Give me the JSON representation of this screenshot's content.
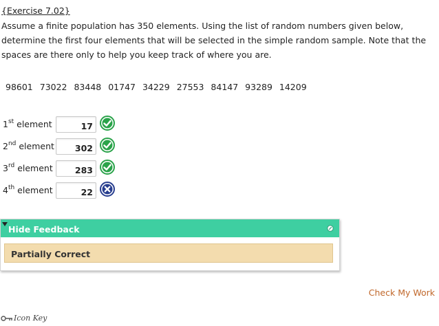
{
  "exercise": {
    "title": "{Exercise 7.02}"
  },
  "question": {
    "text": "Assume a finite population has 350 elements. Using the list of random numbers given below, determine the first four elements that will be selected in the simple random sample. Note that the spaces are there only to help you keep track of where you are."
  },
  "random_numbers": "98601 73022 83448 01747 34229 27553 84147 93289 14209",
  "answers": [
    {
      "ordinal": "1",
      "suffix": "st",
      "label": " element",
      "value": "17",
      "status": "correct",
      "icon": "check-circle-icon"
    },
    {
      "ordinal": "2",
      "suffix": "nd",
      "label": " element",
      "value": "302",
      "status": "correct",
      "icon": "check-circle-icon"
    },
    {
      "ordinal": "3",
      "suffix": "rd",
      "label": " element",
      "value": "283",
      "status": "correct",
      "icon": "check-circle-icon"
    },
    {
      "ordinal": "4",
      "suffix": "th",
      "label": " element",
      "value": "22",
      "status": "incorrect",
      "icon": "x-circle-icon"
    }
  ],
  "feedback": {
    "toggle_label": "Hide Feedback",
    "result": "Partially Correct",
    "header_color": "#3ecfa1",
    "result_bg": "#f3dcae"
  },
  "actions": {
    "check_work": "Check My Work"
  },
  "footer": {
    "icon_key_label": "Icon Key"
  },
  "colors": {
    "correct": "#2aa34a",
    "incorrect": "#283e8f",
    "link": "#c0672a"
  }
}
